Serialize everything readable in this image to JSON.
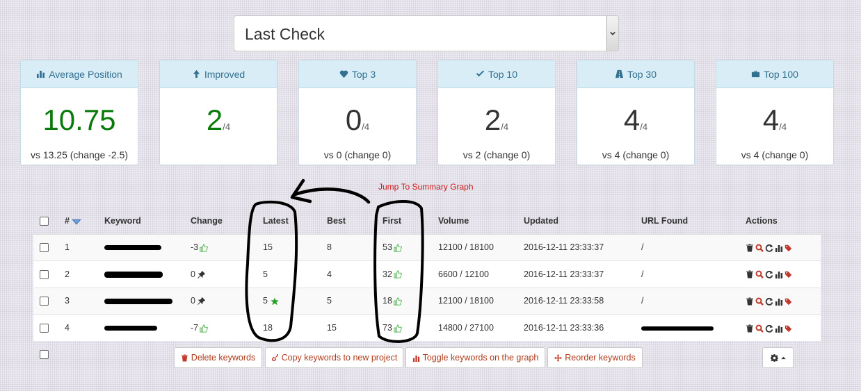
{
  "period_select": {
    "value": "Last Check"
  },
  "cards": [
    {
      "title": "Average Position",
      "icon": "bar-chart-icon",
      "value": "10.75",
      "denominator": "",
      "sub": "vs 13.25 (change -2.5)",
      "value_color": "#0a7a0a"
    },
    {
      "title": "Improved",
      "icon": "arrow-up-icon",
      "value": "2",
      "denominator": "/4",
      "sub": "",
      "value_color": "#0a7a0a"
    },
    {
      "title": "Top 3",
      "icon": "heart-icon",
      "value": "0",
      "denominator": "/4",
      "sub": "vs 0 (change 0)",
      "value_color": "#333333"
    },
    {
      "title": "Top 10",
      "icon": "checkmark-icon",
      "value": "2",
      "denominator": "/4",
      "sub": "vs 2 (change 0)",
      "value_color": "#333333"
    },
    {
      "title": "Top 30",
      "icon": "road-icon",
      "value": "4",
      "denominator": "/4",
      "sub": "vs 4 (change 0)",
      "value_color": "#333333"
    },
    {
      "title": "Top 100",
      "icon": "briefcase-icon",
      "value": "4",
      "denominator": "/4",
      "sub": "vs 4 (change 0)",
      "value_color": "#333333"
    }
  ],
  "annotation": {
    "text": "Jump To Summary Graph"
  },
  "table": {
    "headers": {
      "num": "#",
      "keyword": "Keyword",
      "change": "Change",
      "latest": "Latest",
      "best": "Best",
      "first": "First",
      "volume": "Volume",
      "updated": "Updated",
      "url": "URL Found",
      "actions": "Actions"
    },
    "rows": [
      {
        "num": "1",
        "change": "-3",
        "change_icon": "thumbs-up-icon",
        "latest": "15",
        "latest_icon": "",
        "best": "8",
        "first": "53",
        "volume": "12100 / 18100",
        "updated": "2016-12-11 23:33:37",
        "url": "/"
      },
      {
        "num": "2",
        "change": "0",
        "change_icon": "pin-icon",
        "latest": "5",
        "latest_icon": "",
        "best": "4",
        "first": "32",
        "volume": "6600 / 12100",
        "updated": "2016-12-11 23:33:37",
        "url": "/"
      },
      {
        "num": "3",
        "change": "0",
        "change_icon": "pin-icon",
        "latest": "5",
        "latest_icon": "star-icon",
        "best": "5",
        "first": "18",
        "volume": "12100 / 18100",
        "updated": "2016-12-11 23:33:58",
        "url": "/"
      },
      {
        "num": "4",
        "change": "-7",
        "change_icon": "thumbs-up-icon",
        "latest": "18",
        "latest_icon": "",
        "best": "15",
        "first": "73",
        "volume": "14800 / 27100",
        "updated": "2016-12-11 23:33:36",
        "url": ""
      }
    ]
  },
  "buttons": {
    "delete": "Delete keywords",
    "copy": "Copy keywords to new project",
    "toggle": "Toggle keywords on the graph",
    "reorder": "Reorder keywords"
  },
  "colors": {
    "header_bg": "#d9edf7",
    "header_text": "#31708f",
    "action_red": "#c0392b",
    "positive": "#0a7a0a"
  }
}
